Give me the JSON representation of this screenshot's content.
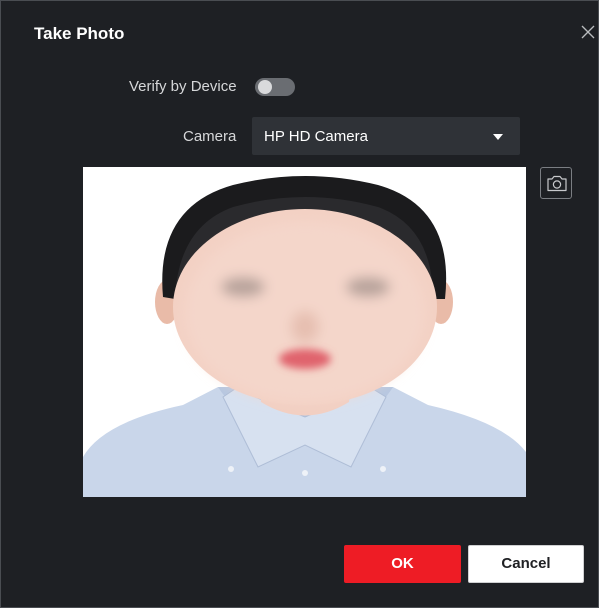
{
  "dialog": {
    "title": "Take Photo",
    "verify_by_device": {
      "label": "Verify by Device",
      "enabled": false
    },
    "camera": {
      "label": "Camera",
      "selected": "HP HD Camera"
    },
    "photo_preview": {
      "icon": "person-portrait"
    },
    "capture_icon": "camera-icon",
    "buttons": {
      "ok": "OK",
      "cancel": "Cancel"
    }
  },
  "colors": {
    "background": "#1e2024",
    "primary": "#ee1c25",
    "select_bg": "#2f3237"
  }
}
